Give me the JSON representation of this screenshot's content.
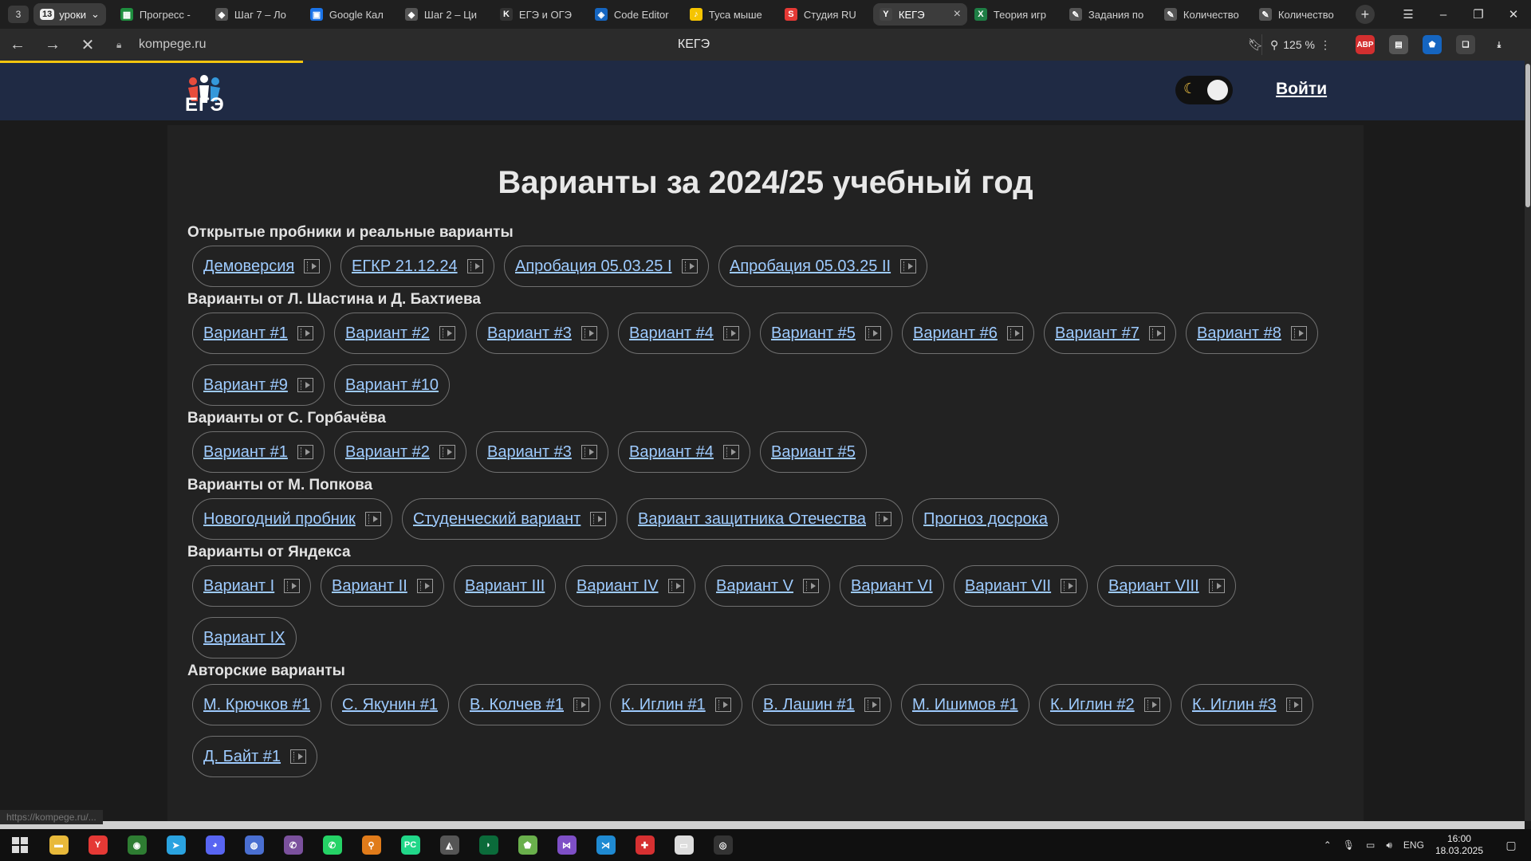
{
  "browser": {
    "tab_count": "3",
    "group_number": "13",
    "group_label": "уроки",
    "tabs": [
      {
        "label": "Прогресс -",
        "icon": "sheets-icon",
        "color": "#1e8e3e",
        "glyph": "▦"
      },
      {
        "label": "Шаг 7 – Ло",
        "icon": "stepik-icon",
        "color": "#555555",
        "glyph": "◆"
      },
      {
        "label": "Google Кал",
        "icon": "calendar-icon",
        "color": "#1a73e8",
        "glyph": "▣"
      },
      {
        "label": "Шаг 2 – Ци",
        "icon": "stepik-icon",
        "color": "#555555",
        "glyph": "◆"
      },
      {
        "label": "ЕГЭ и ОГЭ",
        "icon": "k-icon",
        "color": "#333333",
        "glyph": "K"
      },
      {
        "label": "Code Editor",
        "icon": "code-editor-icon",
        "color": "#1565c0",
        "glyph": "◈"
      },
      {
        "label": "Туса мыше",
        "icon": "yandex-music-icon",
        "color": "#f5c400",
        "glyph": "♪"
      },
      {
        "label": "Студия RU",
        "icon": "studio-icon",
        "color": "#e53935",
        "glyph": "S"
      },
      {
        "label": "КЕГЭ",
        "icon": "yandex-icon",
        "color": "#444444",
        "glyph": "Y",
        "active": true
      },
      {
        "label": "Теория игр",
        "icon": "excel-icon",
        "color": "#1e7e45",
        "glyph": "X"
      },
      {
        "label": "Задания по",
        "icon": "doc-icon",
        "color": "#555555",
        "glyph": "✎"
      },
      {
        "label": "Количество",
        "icon": "doc-icon",
        "color": "#555555",
        "glyph": "✎"
      },
      {
        "label": "Количество",
        "icon": "doc-icon",
        "color": "#555555",
        "glyph": "✎"
      }
    ],
    "url": "kompege.ru",
    "page_title": "КЕГЭ",
    "zoom": "125 %",
    "status_url": "https://kompege.ru/..."
  },
  "site": {
    "logo_text": "ЕГЭ",
    "login_label": "Войти",
    "main_title": "Варианты за 2024/25 учебный год"
  },
  "sections": [
    {
      "title": "Открытые пробники и реальные варианты",
      "rows": [
        [
          {
            "label": "Демоверсия",
            "video": true
          },
          {
            "label": "ЕГКР 21.12.24",
            "video": true
          },
          {
            "label": "Апробация 05.03.25 I",
            "video": true
          },
          {
            "label": "Апробация 05.03.25 II",
            "video": true
          }
        ]
      ]
    },
    {
      "title": "Варианты от Л. Шастина и Д. Бахтиева",
      "rows": [
        [
          {
            "label": "Вариант #1",
            "video": true
          },
          {
            "label": "Вариант #2",
            "video": true
          },
          {
            "label": "Вариант #3",
            "video": true
          },
          {
            "label": "Вариант #4",
            "video": true
          },
          {
            "label": "Вариант #5",
            "video": true
          },
          {
            "label": "Вариант #6",
            "video": true
          },
          {
            "label": "Вариант #7",
            "video": true
          },
          {
            "label": "Вариант #8",
            "video": true
          }
        ],
        [
          {
            "label": "Вариант #9",
            "video": true
          },
          {
            "label": "Вариант #10",
            "video": false
          }
        ]
      ]
    },
    {
      "title": "Варианты от С. Горбачёва",
      "rows": [
        [
          {
            "label": "Вариант #1",
            "video": true
          },
          {
            "label": "Вариант #2",
            "video": true
          },
          {
            "label": "Вариант #3",
            "video": true
          },
          {
            "label": "Вариант #4",
            "video": true
          },
          {
            "label": "Вариант #5",
            "video": false
          }
        ]
      ]
    },
    {
      "title": "Варианты от М. Попкова",
      "rows": [
        [
          {
            "label": "Новогодний пробник",
            "video": true
          },
          {
            "label": "Студенческий вариант",
            "video": true
          },
          {
            "label": "Вариант защитника Отечества",
            "video": true
          },
          {
            "label": "Прогноз досрока",
            "video": false
          }
        ]
      ]
    },
    {
      "title": "Варианты от Яндекса",
      "rows": [
        [
          {
            "label": "Вариант I",
            "video": true
          },
          {
            "label": "Вариант II",
            "video": true
          },
          {
            "label": "Вариант III",
            "video": false
          },
          {
            "label": "Вариант IV",
            "video": true
          },
          {
            "label": "Вариант V",
            "video": true
          },
          {
            "label": "Вариант VI",
            "video": false
          },
          {
            "label": "Вариант VII",
            "video": true
          },
          {
            "label": "Вариант VIII",
            "video": true
          }
        ],
        [
          {
            "label": "Вариант IX",
            "video": false
          }
        ]
      ]
    },
    {
      "title": "Авторские варианты",
      "rows": [
        [
          {
            "label": "М. Крючков #1",
            "video": false
          },
          {
            "label": "С. Якунин #1",
            "video": false
          },
          {
            "label": "В. Колчев #1",
            "video": true
          },
          {
            "label": "К. Иглин #1",
            "video": true
          },
          {
            "label": "В. Лашин #1",
            "video": true
          },
          {
            "label": "М. Ишимов #1",
            "video": false
          },
          {
            "label": "К. Иглин #2",
            "video": true
          },
          {
            "label": "К. Иглин #3",
            "video": true
          }
        ],
        [
          {
            "label": "Д. Байт #1",
            "video": true
          }
        ]
      ]
    }
  ],
  "taskbar": {
    "apps": [
      {
        "name": "file-explorer-icon",
        "color": "#e8b93a",
        "glyph": "▬"
      },
      {
        "name": "yandex-browser-icon",
        "color": "#e53935",
        "glyph": "Y"
      },
      {
        "name": "chrome-icon",
        "color": "#2e7d32",
        "glyph": "◉"
      },
      {
        "name": "telegram-icon",
        "color": "#2aa3e0",
        "glyph": "➤"
      },
      {
        "name": "discord-icon",
        "color": "#5865f2",
        "glyph": "◕"
      },
      {
        "name": "app-globe-icon",
        "color": "#4a6fd1",
        "glyph": "◍"
      },
      {
        "name": "viber-icon",
        "color": "#7b519d",
        "glyph": "✆"
      },
      {
        "name": "whatsapp-icon",
        "color": "#25d366",
        "glyph": "✆"
      },
      {
        "name": "search-app-icon",
        "color": "#e07b1a",
        "glyph": "⚲"
      },
      {
        "name": "pycharm-icon",
        "color": "#21d789",
        "glyph": "PC"
      },
      {
        "name": "unity-icon",
        "color": "#555555",
        "glyph": "◭"
      },
      {
        "name": "app-dark-icon",
        "color": "#0b6b3a",
        "glyph": "◗"
      },
      {
        "name": "shield-app-icon",
        "color": "#6ab04c",
        "glyph": "⬟"
      },
      {
        "name": "visual-studio-icon",
        "color": "#7e4fc6",
        "glyph": "⋈"
      },
      {
        "name": "vscode-icon",
        "color": "#1f8ad2",
        "glyph": "⋊"
      },
      {
        "name": "app-red-icon",
        "color": "#d63031",
        "glyph": "✚"
      },
      {
        "name": "app-window-icon",
        "color": "#dddddd",
        "glyph": "▭"
      },
      {
        "name": "obs-icon",
        "color": "#333333",
        "glyph": "◎"
      }
    ],
    "lang": "ENG",
    "time": "16:00",
    "date": "18.03.2025"
  }
}
